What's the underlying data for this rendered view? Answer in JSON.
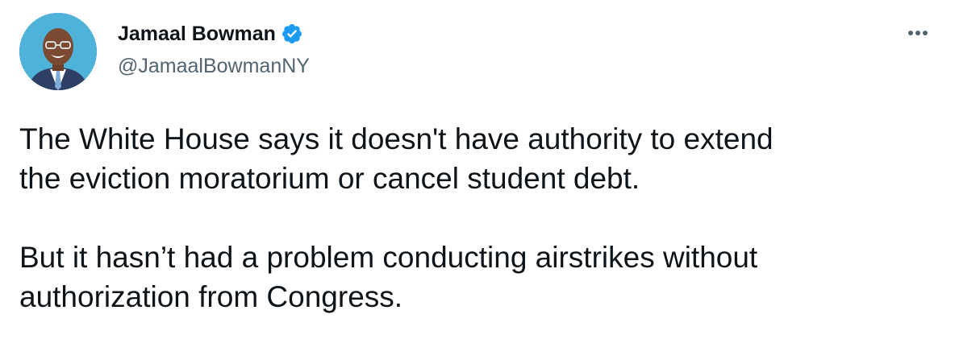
{
  "author": {
    "display_name": "Jamaal Bowman",
    "handle": "@JamaalBowmanNY",
    "verified": true,
    "verified_icon": "verified-badge-icon"
  },
  "menu": {
    "icon": "more-options-icon"
  },
  "tweet": {
    "paragraph1_line1": "The White House says it doesn't have authority to extend",
    "paragraph1_line2": "the eviction moratorium or cancel student debt.",
    "paragraph2_line1": "But it hasn’t had a problem conducting airstrikes without",
    "paragraph2_line2": "authorization from Congress."
  },
  "colors": {
    "text": "#0f1419",
    "secondary": "#536471",
    "verified": "#1d9bf0",
    "avatar_bg": "#4fb3d9"
  }
}
